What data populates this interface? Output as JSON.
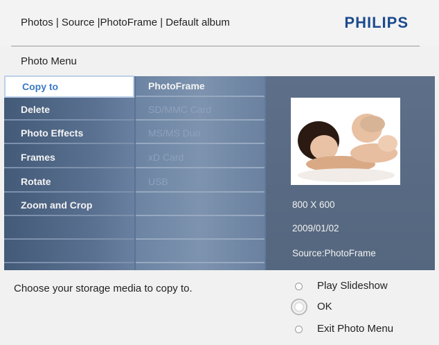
{
  "header": {
    "breadcrumb": "Photos | Source |PhotoFrame | Default album",
    "brand": "PHILIPS"
  },
  "menu": {
    "title": "Photo Menu",
    "items": [
      {
        "label": "Copy to"
      },
      {
        "label": "Delete"
      },
      {
        "label": "Photo Effects"
      },
      {
        "label": "Frames"
      },
      {
        "label": "Rotate"
      },
      {
        "label": "Zoom and Crop"
      }
    ],
    "submenu": [
      {
        "label": "PhotoFrame"
      },
      {
        "label": "SD/MMC Card"
      },
      {
        "label": "MS/MS Duo"
      },
      {
        "label": "xD Card"
      },
      {
        "label": "USB"
      }
    ]
  },
  "details": {
    "resolution": "800 X 600",
    "date": "2009/01/02",
    "source": "Source:PhotoFrame"
  },
  "footer": {
    "hint": "Choose your storage media to copy to.",
    "options": {
      "play": "Play Slideshow",
      "ok": "OK",
      "exit": "Exit Photo Menu"
    }
  }
}
